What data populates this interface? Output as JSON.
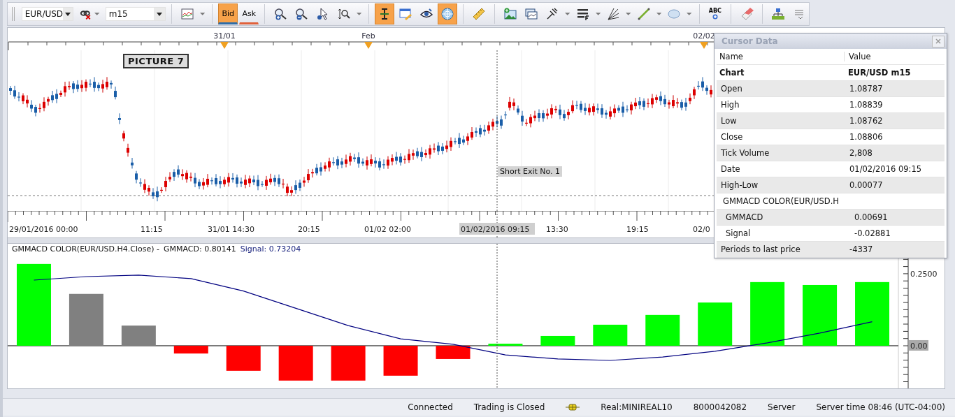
{
  "toolbar": {
    "symbol": "EUR/USD",
    "timeframe": "m15",
    "tools": [
      {
        "selected": false
      },
      {
        "label": "Bid",
        "selected": true
      },
      {
        "label": "Ask",
        "selected": false
      },
      {
        "selected": false
      },
      {
        "selected": false
      },
      {
        "selected": false
      },
      {
        "selected": false
      },
      {
        "selected": true
      },
      {
        "selected": false
      },
      {
        "selected": false
      },
      {
        "selected": true
      },
      {
        "selected": false
      },
      {
        "selected": false
      },
      {
        "selected": false
      },
      {
        "selected": false
      },
      {
        "selected": false
      },
      {
        "selected": false
      },
      {
        "selected": false
      },
      {
        "selected": false
      },
      {
        "label": "ABC",
        "selected": false
      },
      {
        "selected": false
      },
      {
        "selected": false
      },
      {
        "selected": false
      }
    ]
  },
  "chart": {
    "top_axis_labels": [
      "31/01",
      "Feb",
      "02/02"
    ],
    "note": "PICTURE 7",
    "marker_label": "Short Exit No. 1",
    "time_labels": [
      {
        "text": "29/01/2016 00:00",
        "highlighted": false
      },
      {
        "text": "11:15",
        "highlighted": false
      },
      {
        "text": "31/01 14:30",
        "highlighted": false
      },
      {
        "text": "20:15",
        "highlighted": false
      },
      {
        "text": "01/02 02:00",
        "highlighted": false
      },
      {
        "text": "01/02/2016 09:15",
        "highlighted": true
      },
      {
        "text": "13:30",
        "highlighted": false
      },
      {
        "text": "19:15",
        "highlighted": false
      },
      {
        "text": "02/0",
        "highlighted": false
      }
    ]
  },
  "indicator": {
    "title": "GMMACD COLOR(EUR/USD.H4.Close) -",
    "gmmacd_reading": ": 0.80141",
    "signal_reading": ": 0.73204",
    "chart_data": {
      "type": "bar",
      "categories": [
        null,
        null,
        null,
        null,
        null,
        null,
        null,
        null,
        null,
        null,
        null,
        null,
        null,
        null,
        null,
        null,
        null
      ],
      "ylim": [
        -0.148,
        0.354
      ],
      "yticks": [
        {
          "value": 0,
          "label": "0.00"
        },
        {
          "value": 0.25,
          "label": "0.2500"
        }
      ],
      "series": [
        {
          "name": "GMMACD",
          "values": [
            0.284,
            0.18,
            0.07,
            -0.027,
            -0.087,
            -0.121,
            -0.121,
            -0.104,
            -0.046,
            0.007,
            0.034,
            0.073,
            0.107,
            0.15,
            0.221,
            0.211,
            0.221
          ],
          "colors": [
            "#00ff00",
            "#808080",
            "#808080",
            "#ff0000",
            "#ff0000",
            "#ff0000",
            "#ff0000",
            "#ff0000",
            "#ff0000",
            "#00ff00",
            "#00ff00",
            "#00ff00",
            "#00ff00",
            "#00ff00",
            "#00ff00",
            "#00ff00",
            "#00ff00"
          ]
        },
        {
          "name": "Signal",
          "type": "line",
          "color": "#000080",
          "values": [
            0.228,
            0.24,
            0.245,
            0.233,
            0.19,
            0.13,
            0.07,
            0.024,
            0.005,
            -0.032,
            -0.046,
            -0.051,
            -0.039,
            -0.019,
            0.01,
            0.044,
            0.083
          ]
        }
      ]
    }
  },
  "cursor_data": {
    "title": "Cursor Data",
    "columns": [
      "Name",
      "Value"
    ],
    "rows": [
      {
        "kind": "header",
        "name": "Chart",
        "value": "EUR/USD m15"
      },
      {
        "kind": "row",
        "name": "Open",
        "value": "1.08787"
      },
      {
        "kind": "row",
        "name": "High",
        "value": "1.08839"
      },
      {
        "kind": "row",
        "name": "Low",
        "value": "1.08762"
      },
      {
        "kind": "row",
        "name": "Close",
        "value": "1.08806"
      },
      {
        "kind": "row",
        "name": "Tick Volume",
        "value": "2,808"
      },
      {
        "kind": "row",
        "name": "Date",
        "value": "01/02/2016 09:15"
      },
      {
        "kind": "row",
        "name": "High-Low",
        "value": "0.00077"
      },
      {
        "kind": "group",
        "name": "GMMACD COLOR(EUR/USD.H"
      },
      {
        "kind": "sub",
        "name": "GMMACD",
        "value": "0.00691"
      },
      {
        "kind": "sub",
        "name": "Signal",
        "value": "-0.02881"
      },
      {
        "kind": "row",
        "name": "Periods to last price",
        "value": "-4337"
      }
    ]
  },
  "status_bar": {
    "connection": "Connected",
    "trading": "Trading is Closed",
    "account": "Real:MINIREAL10",
    "account_number": "8000042082",
    "server": "Server",
    "server_time": "Server time 08:46 (UTC-04:00)"
  }
}
